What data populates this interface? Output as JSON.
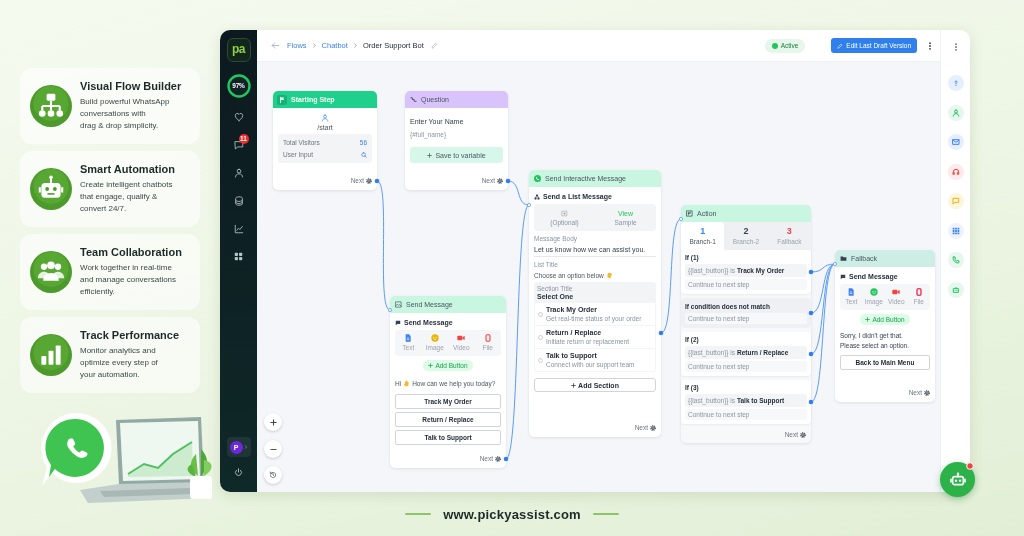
{
  "features": [
    {
      "title": "Visual Flow Builder",
      "description_lines": [
        "Build powerful WhatsApp",
        "conversations with",
        "drag & drop simplicity."
      ]
    },
    {
      "title": "Smart Automation",
      "description_lines": [
        "Create intelligent chatbots",
        "that engage, qualify &",
        "convert 24/7."
      ]
    },
    {
      "title": "Team Collaboration",
      "description_lines": [
        "Work together in real-time",
        "and manage conversations",
        "efficiently."
      ]
    },
    {
      "title": "Track Performance",
      "description_lines": [
        "Monitor analytics and",
        "optimize every step of",
        "your automation."
      ]
    }
  ],
  "app": {
    "sidebar": {
      "logo": "pa",
      "usage_label": "97%",
      "chat_badge": "11",
      "avatar": "P"
    },
    "breadcrumbs": [
      {
        "label": "Flows",
        "kind": "link"
      },
      {
        "label": "Chatbot",
        "kind": "link"
      },
      {
        "label": "Order Support Bot",
        "kind": "current"
      }
    ],
    "status": "Active",
    "edit_button": "Edit Last Draft Version",
    "canvas": {
      "start_step": {
        "title": "Starting Step",
        "trigger": "/start",
        "stats": [
          {
            "label": "Total Visitors",
            "value": "56"
          },
          {
            "label": "User Input"
          }
        ],
        "next": "Next"
      },
      "question": {
        "title": "Question",
        "prompt": "Enter Your Name",
        "variable": "{#full_name}",
        "save_button": "Save to variable",
        "next": "Next"
      },
      "send_message": {
        "title": "Send Message",
        "heading": "Send Message",
        "media": [
          {
            "label": "Text",
            "color": "#3b82f6"
          },
          {
            "label": "Image",
            "color": "#eab308"
          },
          {
            "label": "Video",
            "color": "#ef4444"
          },
          {
            "label": "File",
            "color": "#f87171"
          }
        ],
        "add_button": "Add Button",
        "greeting": "Hi",
        "message": "How can we help you today?",
        "buttons": [
          "Track My Order",
          "Return / Replace",
          "Talk to Support"
        ],
        "next": "Next"
      },
      "interactive": {
        "title": "Send Interactive Message",
        "heading": "Send a List Message",
        "header_media": "(Optional)",
        "sample_link": "View",
        "sample_label": "Sample",
        "body_label": "Message Body",
        "body": "Let us know how we can assist you.",
        "list_title_label": "List Title",
        "list_title": "Choose an option below",
        "section_label": "Section Title",
        "section_title": "Select One",
        "rows": [
          {
            "title": "Track My Order",
            "description": "Get real-time status of your order"
          },
          {
            "title": "Return / Replace",
            "description": "Initiate return or replacement"
          },
          {
            "title": "Talk to Support",
            "description": "Connect with our support team"
          }
        ],
        "add_section": "Add Section",
        "next": "Next"
      },
      "action": {
        "title": "Action",
        "branches": [
          {
            "number": "1",
            "label": "Branch-1",
            "selected": true,
            "color": "#3b82f6"
          },
          {
            "number": "2",
            "label": "Branch-2",
            "selected": false,
            "color": "#374151"
          },
          {
            "number": "3",
            "label": "Fallback",
            "selected": false,
            "color": "#ef4444"
          }
        ],
        "conditions": [
          {
            "kind": "if",
            "label": "If (1)",
            "rule": "{{last_button}} is **Track My Order**",
            "outcome": "Continue to next step"
          },
          {
            "kind": "else",
            "label": "If condition does not match",
            "outcome": "Continue to next step"
          },
          {
            "kind": "if",
            "label": "If (2)",
            "rule": "{{last_button}} is **Return / Replace**",
            "outcome": "Continue to next step"
          },
          {
            "kind": "if",
            "label": "If (3)",
            "rule": "{{last_button}} is **Talk to Support**",
            "outcome": "Continue to next step"
          }
        ],
        "next": "Next"
      },
      "fallback": {
        "title": "Fallback",
        "heading": "Send Message",
        "media": [
          {
            "label": "Text",
            "color": "#3b82f6"
          },
          {
            "label": "Image",
            "color": "#22c55e"
          },
          {
            "label": "Video",
            "color": "#ef4444"
          },
          {
            "label": "File",
            "color": "#f43f5e"
          }
        ],
        "add_button": "Add Button",
        "lines": [
          "Sorry, I didn't get that.",
          "Please select an option."
        ],
        "button": "Back to Main Menu",
        "next": "Next"
      }
    }
  },
  "footer": "www.pickyassist.com"
}
